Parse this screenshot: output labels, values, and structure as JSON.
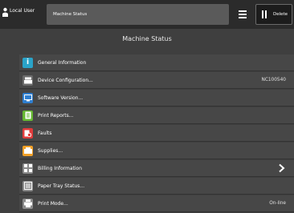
{
  "header": {
    "user_label": "Local User",
    "breadcrumb": "Machine Status",
    "delete_label": "Delete"
  },
  "page": {
    "title": "Machine Status"
  },
  "colors": {
    "info": "#2aa3c8",
    "device": "#6b6b6b",
    "software": "#2f7fd0",
    "print_reports": "#66b832",
    "faults": "#e03b3b",
    "supplies": "#f0a028",
    "billing": "#8a8a8a",
    "paper_tray": "#8a8a8a",
    "print_mode": "#8a8a8a"
  },
  "items": [
    {
      "label": "General Information",
      "icon": "info-icon",
      "value": ""
    },
    {
      "label": "Device Configuration...",
      "icon": "device-icon",
      "value": "NC100540"
    },
    {
      "label": "Software Version...",
      "icon": "software-icon",
      "value": ""
    },
    {
      "label": "Print Reports...",
      "icon": "report-icon",
      "value": ""
    },
    {
      "label": "Faults",
      "icon": "fault-icon",
      "value": ""
    },
    {
      "label": "Supplies...",
      "icon": "supplies-icon",
      "value": ""
    },
    {
      "label": "Billing Information",
      "icon": "billing-icon",
      "value": ""
    },
    {
      "label": "Paper Tray Status...",
      "icon": "paper-tray-icon",
      "value": ""
    },
    {
      "label": "Print Mode...",
      "icon": "print-mode-icon",
      "value": "On-line"
    }
  ]
}
